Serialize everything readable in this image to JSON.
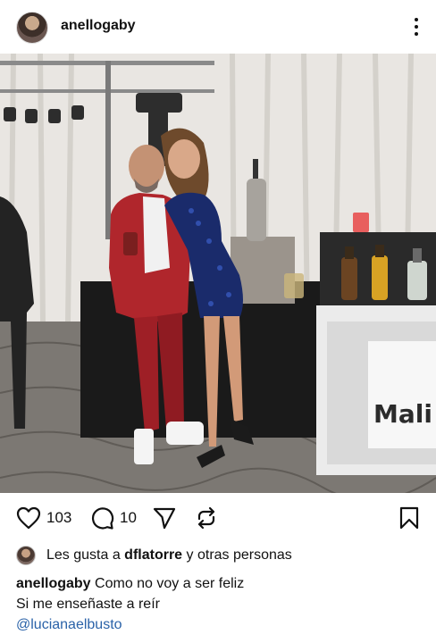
{
  "post": {
    "username": "anellogaby",
    "image_alt": "Two people posing at a party"
  },
  "actions": {
    "like_count": "103",
    "comment_count": "10"
  },
  "likes": {
    "prefix": "Les gusta a ",
    "user": "dflatorre",
    "suffix": " y otras personas"
  },
  "caption": {
    "username": "anellogaby",
    "line1": "Como no voy a ser feliz",
    "line2": "Si me enseñaste a reír",
    "mention": "@lucianaelbusto"
  },
  "photo": {
    "sign_text": "Mali"
  },
  "icons": {
    "like": "heart-icon",
    "comment": "comment-bubble-icon",
    "share": "paper-plane-icon",
    "repost": "repost-icon",
    "save": "bookmark-icon",
    "more": "more-vertical-icon"
  }
}
